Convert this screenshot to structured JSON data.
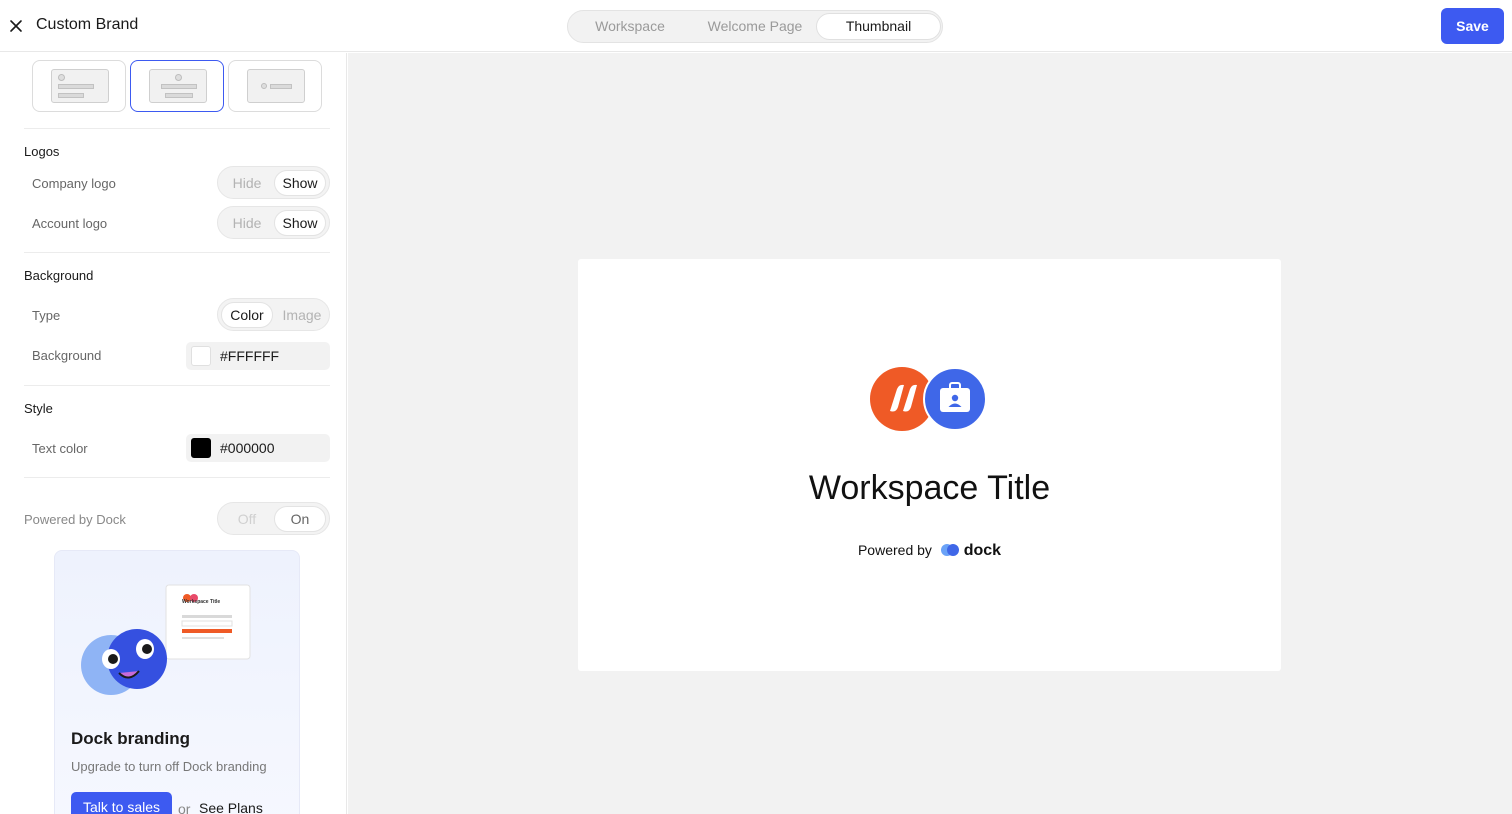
{
  "header": {
    "title": "Custom Brand",
    "tabs": [
      {
        "label": "Workspace",
        "active": false
      },
      {
        "label": "Welcome Page",
        "active": false
      },
      {
        "label": "Thumbnail",
        "active": true
      }
    ],
    "save_label": "Save"
  },
  "sidebar": {
    "layout_options": [
      {
        "name": "layout-stacked-left",
        "selected": false
      },
      {
        "name": "layout-stacked-center",
        "selected": true
      },
      {
        "name": "layout-inline",
        "selected": false
      }
    ],
    "logos": {
      "heading": "Logos",
      "company_logo": {
        "label": "Company logo",
        "hide": "Hide",
        "show": "Show",
        "value": "Show"
      },
      "account_logo": {
        "label": "Account logo",
        "hide": "Hide",
        "show": "Show",
        "value": "Show"
      }
    },
    "background": {
      "heading": "Background",
      "type": {
        "label": "Type",
        "color": "Color",
        "image": "Image",
        "value": "Color"
      },
      "color": {
        "label": "Background",
        "value": "#FFFFFF"
      }
    },
    "style": {
      "heading": "Style",
      "text_color": {
        "label": "Text color",
        "value": "#000000"
      }
    },
    "powered_by": {
      "label": "Powered by Dock",
      "off": "Off",
      "on": "On",
      "value": "On"
    },
    "promo": {
      "title": "Dock branding",
      "subtitle": "Upgrade to turn off Dock branding",
      "talk_label": "Talk to sales",
      "or_text": "or",
      "see_plans_label": "See Plans",
      "mock_title": "Workspace Title"
    }
  },
  "preview": {
    "title": "Workspace Title",
    "powered_text": "Powered by",
    "brand": "dock"
  },
  "colors": {
    "accent": "#3d5af1",
    "logo_orange": "#ef5a26",
    "logo_blue": "#3f67e8"
  }
}
